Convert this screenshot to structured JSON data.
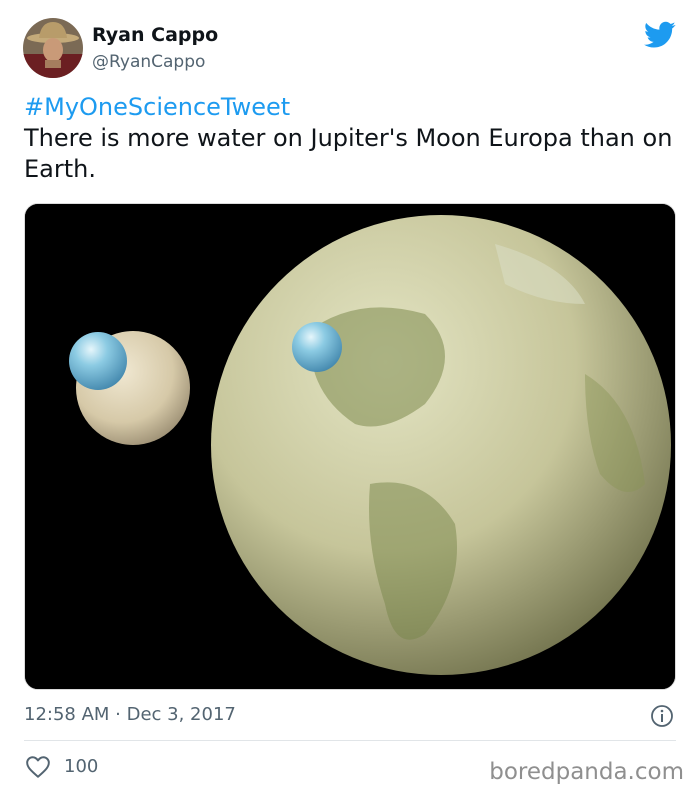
{
  "tweet": {
    "author_name": "Ryan Cappo",
    "author_handle": "@RyanCappo",
    "hashtag": "#MyOneScienceTweet",
    "body": "There is more water on Jupiter's Moon Europa than on Earth.",
    "timestamp": "12:58 AM · Dec 3, 2017",
    "like_count": "100"
  },
  "watermark": "boredpanda.com",
  "colors": {
    "accent": "#1d9bf0",
    "secondary_text": "#536471"
  },
  "icons": {
    "brand": "twitter-bird-icon",
    "info": "info-icon",
    "like": "heart-icon"
  }
}
